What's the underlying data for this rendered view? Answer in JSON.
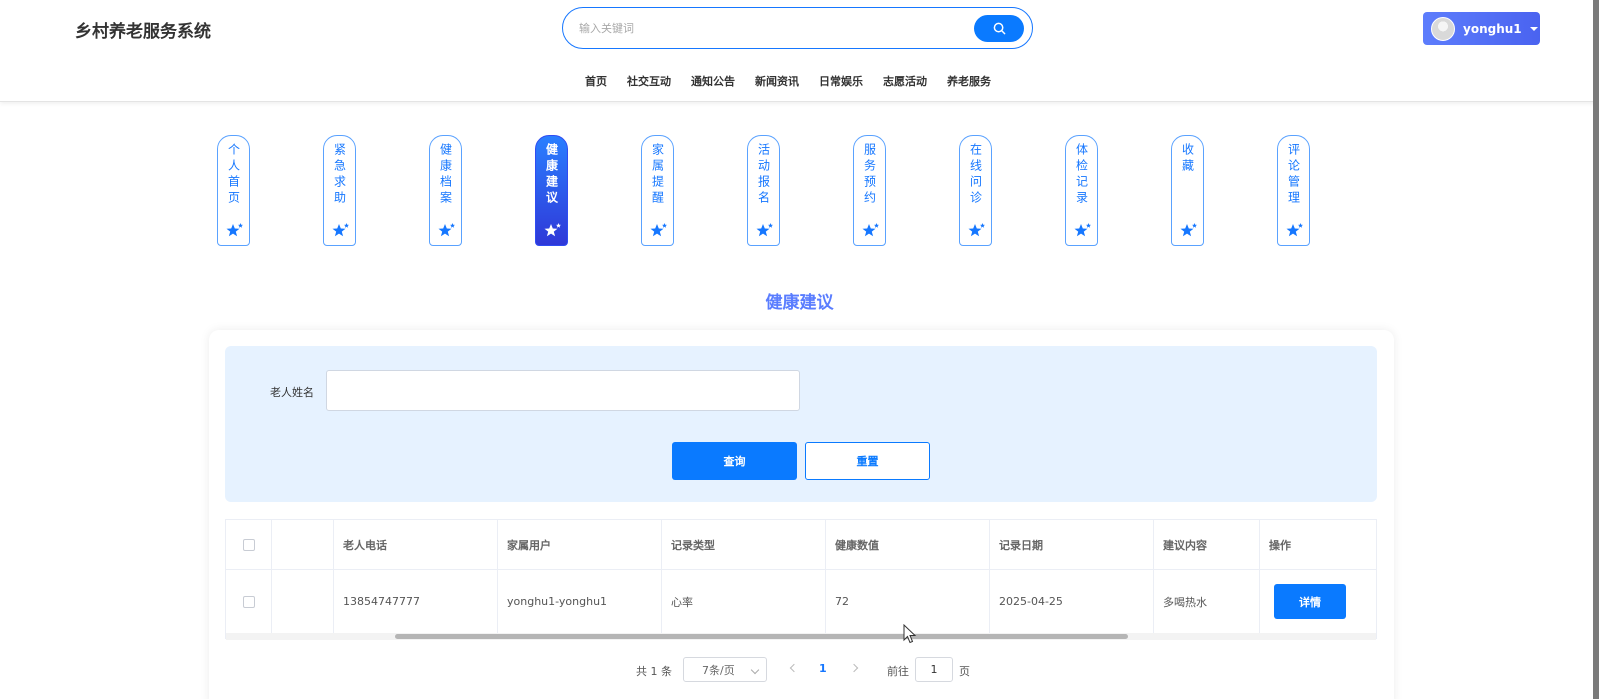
{
  "header": {
    "site_title": "乡村养老服务系统",
    "search_placeholder": "输入关键词",
    "user_name": "yonghu1",
    "nav": [
      "首页",
      "社交互动",
      "通知公告",
      "新闻资讯",
      "日常娱乐",
      "志愿活动",
      "养老服务"
    ]
  },
  "tabs": [
    {
      "label": "个人首页",
      "active": false
    },
    {
      "label": "紧急求助",
      "active": false
    },
    {
      "label": "健康档案",
      "active": false
    },
    {
      "label": "健康建议",
      "active": true
    },
    {
      "label": "家属提醒",
      "active": false
    },
    {
      "label": "活动报名",
      "active": false
    },
    {
      "label": "服务预约",
      "active": false
    },
    {
      "label": "在线问诊",
      "active": false
    },
    {
      "label": "体检记录",
      "active": false
    },
    {
      "label": "收藏",
      "active": false
    },
    {
      "label": "评论管理",
      "active": false
    }
  ],
  "section_title": "健康建议",
  "filter": {
    "label": "老人姓名",
    "value": "",
    "query_label": "查询",
    "reset_label": "重置"
  },
  "table": {
    "columns": [
      "老人电话",
      "家属用户",
      "记录类型",
      "健康数值",
      "记录日期",
      "建议内容",
      "操作"
    ],
    "rows": [
      {
        "phone": "13854747777",
        "family_user": "yonghu1-yonghu1",
        "record_type": "心率",
        "health_value": "72",
        "record_date": "2025-04-25",
        "advice": "多喝热水",
        "action_label": "详情"
      }
    ]
  },
  "pagination": {
    "total": "共 1 条",
    "page_size": "7条/页",
    "current": "1",
    "goto_label": "前往",
    "goto_value": "1",
    "page_suffix": "页"
  },
  "colors": {
    "primary": "#0a7aff",
    "title_accent": "#5a7dff",
    "filter_bg": "#e6f2ff"
  }
}
